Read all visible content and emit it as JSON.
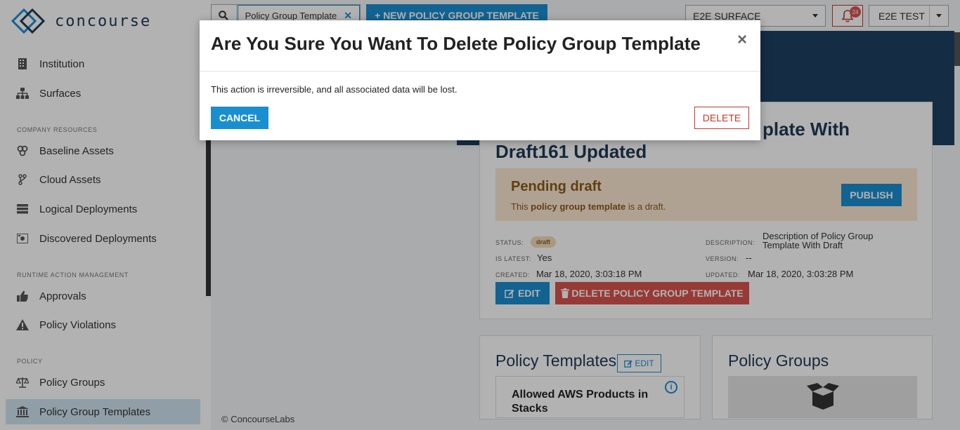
{
  "app": {
    "logo_text": "concourse"
  },
  "sidebar": {
    "top_items": [
      {
        "label": "Institution",
        "icon": "building-icon"
      },
      {
        "label": "Surfaces",
        "icon": "sitemap-icon"
      }
    ],
    "sections": [
      {
        "label": "COMPANY RESOURCES",
        "items": [
          {
            "label": "Baseline Assets",
            "icon": "cubes-icon"
          },
          {
            "label": "Cloud Assets",
            "icon": "code-fork-icon"
          },
          {
            "label": "Logical Deployments",
            "icon": "server-icon"
          },
          {
            "label": "Discovered Deployments",
            "icon": "discovered-icon"
          }
        ]
      },
      {
        "label": "RUNTIME ACTION MANAGEMENT",
        "items": [
          {
            "label": "Approvals",
            "icon": "thumbs-up-icon"
          },
          {
            "label": "Policy Violations",
            "icon": "warning-icon"
          }
        ]
      },
      {
        "label": "POLICY",
        "items": [
          {
            "label": "Policy Groups",
            "icon": "balance-scale-icon"
          },
          {
            "label": "Policy Group Templates",
            "icon": "institution-icon",
            "active": true
          }
        ]
      }
    ]
  },
  "topbar": {
    "search_value": "Policy Group Template",
    "new_button_label": "+ NEW POLICY GROUP TEMPLATE",
    "surface_select": "E2E SURFACE",
    "notification_count": "24",
    "user_label": "E2E TEST"
  },
  "detail": {
    "title_line1": "plate With",
    "title_line2": "Draft161 Updated",
    "draft_title": "Pending draft",
    "draft_desc_pre": "This ",
    "draft_desc_bold": "policy group template",
    "draft_desc_post": " is a draft.",
    "publish_label": "PUBLISH",
    "status_label": "STATUS:",
    "status_value": "draft",
    "is_latest_label": "IS LATEST:",
    "is_latest_value": "Yes",
    "created_label": "CREATED:",
    "created_value": "Mar 18, 2020, 3:03:18 PM",
    "description_label": "DESCRIPTION:",
    "description_value_line1": "Description of Policy Group",
    "description_value_line2": "Template With Draft",
    "version_label": "VERSION:",
    "version_value": "--",
    "updated_label": "UPDATED:",
    "updated_value": "Mar 18, 2020, 3:03:28 PM",
    "edit_label": "EDIT",
    "delete_label": "DELETE POLICY GROUP TEMPLATE"
  },
  "policy_templates": {
    "title": "Policy Templates",
    "edit_label": "EDIT",
    "item_title": "Allowed AWS Products in Stacks"
  },
  "policy_groups": {
    "title": "Policy Groups"
  },
  "footer": {
    "text": "© ConcourseLabs"
  },
  "modal": {
    "title": "Are You Sure You Want To Delete Policy Group Template",
    "close_glyph": "×",
    "body": "This action is irreversible, and all associated data will be lost.",
    "cancel_label": "CANCEL",
    "delete_label": "DELETE"
  },
  "colors": {
    "primary": "#1a8fd0",
    "danger": "#d9534f",
    "navy": "#1f3f63"
  }
}
